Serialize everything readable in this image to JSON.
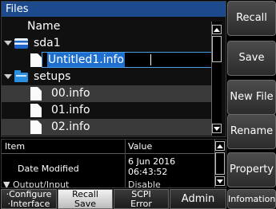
{
  "files": {
    "header": "Files",
    "column_name": "Name",
    "items": [
      {
        "label": "sda1",
        "type": "drive",
        "expanded": true
      },
      {
        "label": "Untitled1.info",
        "type": "file-editing"
      },
      {
        "label": "setups",
        "type": "folder",
        "expanded": true
      },
      {
        "label": "00.info",
        "type": "file",
        "selected": true
      },
      {
        "label": "01.info",
        "type": "file"
      },
      {
        "label": "02.info",
        "type": "file",
        "selected": true
      }
    ],
    "rename_value": "Untitled1.info"
  },
  "details": {
    "col_item": "Item",
    "col_value": "Value",
    "rows": [
      {
        "item": "Date Modified",
        "value_line1": "6 Jun 2016",
        "value_line2": "06:43:52"
      },
      {
        "item": "▼ Output/Input",
        "value": "Disable"
      }
    ]
  },
  "side_buttons": [
    {
      "label": "Recall"
    },
    {
      "label": "Save"
    },
    {
      "label": "New File"
    },
    {
      "label": "Rename"
    },
    {
      "label": "Property"
    },
    {
      "label": "Infomation"
    }
  ],
  "bottom_tabs": [
    {
      "line1": "·Configure",
      "line2": "·Interface"
    },
    {
      "line1": "Recall",
      "line2": "Save",
      "active": true
    },
    {
      "line1": "SCPI",
      "line2": "Error"
    },
    {
      "label": "Admin"
    }
  ],
  "icons": {
    "drive": "usb-drive-icon",
    "folder": "folder-icon",
    "file": "file-icon",
    "expand": "triangle-down-icon"
  },
  "colors": {
    "header_bg": "#1c4a8c",
    "selection_bg": "#3a3a3a",
    "input_border": "#4aa0e6",
    "text_selection": "#1f6fd0"
  }
}
